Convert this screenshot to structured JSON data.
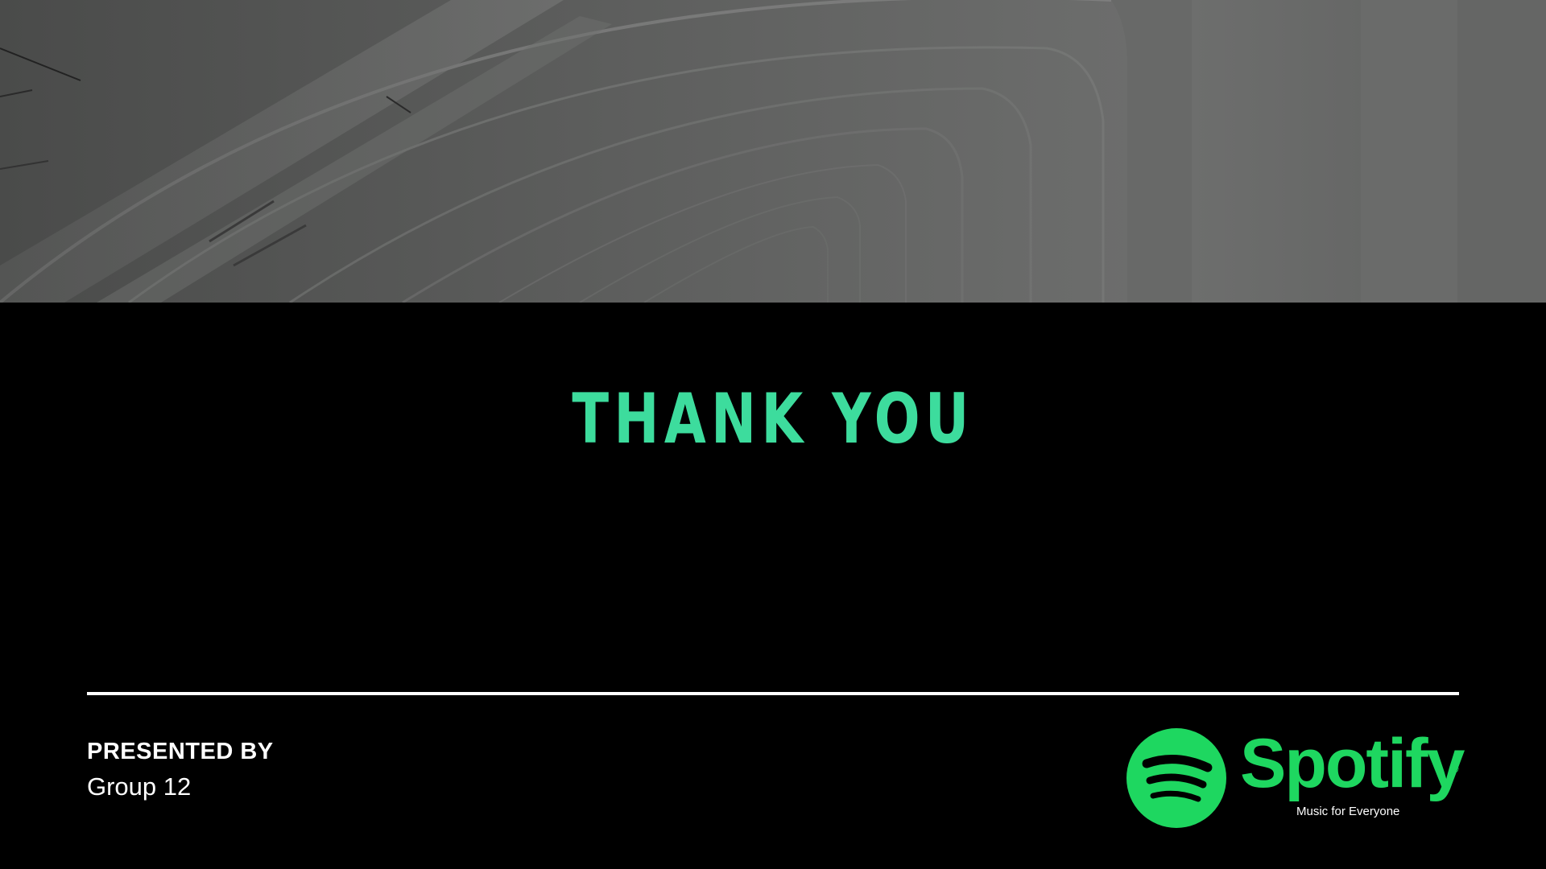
{
  "slide": {
    "title": "THANK YOU",
    "presented_by_label": "PRESENTED BY",
    "presenter": "Group 12"
  },
  "logo": {
    "wordmark": "Spotify",
    "registered_mark": "®",
    "tagline": "Music for Everyone",
    "icon": "spotify-icon"
  },
  "colors": {
    "background": "#000000",
    "title_accent": "#3ddc9d",
    "brand_green": "#1ed760",
    "divider": "#ffffff",
    "text": "#ffffff"
  }
}
